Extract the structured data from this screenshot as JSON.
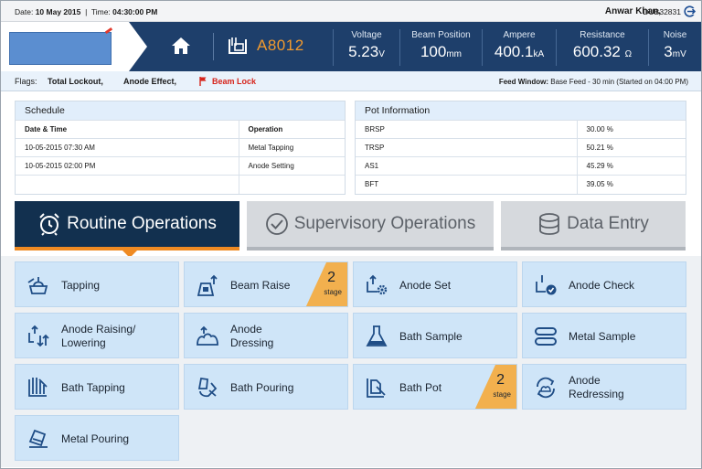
{
  "topbar": {
    "date_label": "Date:",
    "date_value": "10 May 2015",
    "time_label": "Time:",
    "time_value": "04:30:00 PM",
    "user_name": "Anwar Khan,",
    "user_id": "DUB32831"
  },
  "header": {
    "pot_id": "A8012",
    "measurements": [
      {
        "label": "Voltage",
        "value": "5.23",
        "unit": "V"
      },
      {
        "label": "Beam Position",
        "value": "100",
        "unit": "mm"
      },
      {
        "label": "Ampere",
        "value": "400.1",
        "unit": "kA"
      },
      {
        "label": "Resistance",
        "value": "600.32",
        "unit": "Ω"
      },
      {
        "label": "Noise",
        "value": "3",
        "unit": "mV"
      }
    ]
  },
  "flags": {
    "label": "Flags:",
    "items": [
      "Total Lockout,",
      "Anode Effect,",
      "Beam Lock"
    ],
    "feed_label": "Feed Window:",
    "feed_value": "Base Feed - 30 min",
    "feed_note": "(Started on 04:00 PM)"
  },
  "schedule": {
    "title": "Schedule",
    "columns": [
      "Date & Time",
      "Operation"
    ],
    "rows": [
      [
        "10-05-2015  07:30 AM",
        "Metal Tapping"
      ],
      [
        "10-05-2015  02:00 PM",
        "Anode Setting"
      ],
      [
        "",
        ""
      ]
    ]
  },
  "pot_info": {
    "title": "Pot Information",
    "rows": [
      [
        "BRSP",
        "30.00 %"
      ],
      [
        "TRSP",
        "50.21 %"
      ],
      [
        "AS1",
        "45.29 %"
      ],
      [
        "BFT",
        "39.05 %"
      ]
    ]
  },
  "tabs": [
    {
      "label": "Routine Operations",
      "icon": "alarm-clock-icon",
      "active": true
    },
    {
      "label": "Supervisory Operations",
      "icon": "check-circle-icon",
      "active": false
    },
    {
      "label": "Data Entry",
      "icon": "database-icon",
      "active": false
    }
  ],
  "operations": [
    {
      "label": "Tapping",
      "icon": "tapping-icon"
    },
    {
      "label": "Beam Raise",
      "icon": "beam-raise-icon",
      "stage": "2",
      "stage_text": "stage"
    },
    {
      "label": "Anode Set",
      "icon": "anode-set-icon"
    },
    {
      "label": "Anode Check",
      "icon": "anode-check-icon"
    },
    {
      "label": "Anode Raising/ Lowering",
      "icon": "anode-raise-lower-icon"
    },
    {
      "label": "Anode Dressing",
      "icon": "anode-dressing-icon"
    },
    {
      "label": "Bath Sample",
      "icon": "flask-icon"
    },
    {
      "label": "Metal Sample",
      "icon": "metal-sample-icon"
    },
    {
      "label": "Bath Tapping",
      "icon": "bath-tapping-icon"
    },
    {
      "label": "Bath Pouring",
      "icon": "bath-pouring-icon"
    },
    {
      "label": "Bath Pot",
      "icon": "bath-pot-icon",
      "stage": "2",
      "stage_text": "stage"
    },
    {
      "label": "Anode Redressing",
      "icon": "anode-redressing-icon"
    },
    {
      "label": "Metal Pouring",
      "icon": "metal-pouring-icon"
    }
  ],
  "colors": {
    "header_bg": "#1e3f6b",
    "accent_orange": "#ef8a22",
    "op_bg": "#cfe5f8",
    "stage_badge": "#f2b04e",
    "flag_red": "#d6241b"
  }
}
